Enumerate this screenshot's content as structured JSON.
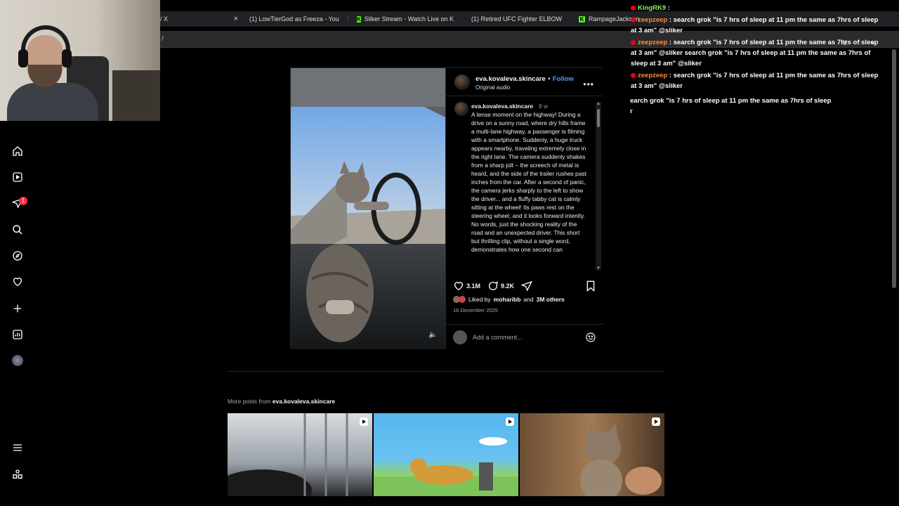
{
  "browser": {
    "tabs": [
      {
        "label": "/ X",
        "favicon": "x-icon"
      },
      {
        "label": "(1) LowTierGod as Freeza - You",
        "favicon": "youtube-icon"
      },
      {
        "label": "Sliker Stream - Watch Live on K",
        "favicon": "kick-icon"
      },
      {
        "label": "(1) Retired UFC Fighter ELBOW",
        "favicon": "youtube-icon"
      },
      {
        "label": "RampageJackson",
        "favicon": "kick-icon"
      }
    ],
    "url": "/"
  },
  "nav": {
    "notification_count": "1"
  },
  "post": {
    "username": "eva.kovaleva.skincare",
    "follow_label": "Follow",
    "separator": "•",
    "audio": "Original audio",
    "caption_user": "eva.kovaleva.skincare",
    "caption_time": "9 w",
    "caption": "A tense moment on the highway! During a drive on a sunny road, where dry hills frame a multi-lane highway, a passenger is filming with a smartphone. Suddenly, a huge truck appears nearby, traveling extremely close in the right lane. The camera suddenly shakes from a sharp jolt – the screech of metal is heard, and the side of the trailer rushes past inches from the car. After a second of panic, the camera jerks sharply to the left to show the driver... and a fluffy tabby cat is calmly sitting at the wheel! Its paws rest on the steering wheel, and it looks forward intently. No words, just the shocking reality of the road and an unexpected driver. This short but thrilling clip, without a single word, demonstrates how one second can",
    "likes": "3.1M",
    "comments": "9.2K",
    "liked_by_prefix": "Liked by",
    "liked_by_user": "moharibb",
    "liked_by_and": "and",
    "liked_by_others": "3M others",
    "date": "16 December 2025",
    "comment_placeholder": "Add a comment..."
  },
  "more_posts": {
    "prefix": "More posts from",
    "user": "eva.kovaleva.skincare"
  },
  "chat": [
    {
      "name": "KingRK9",
      "sep": " :",
      "text": "",
      "color": "#8cf25a"
    },
    {
      "name": "zeepzeep",
      "sep": " :",
      "text": " search grok \"is 7 hrs of sleep at 11 pm the same as 7hrs of sleep at 3 am\" @sliker",
      "color": "#ff8a3d"
    },
    {
      "name": "zeepzeep",
      "sep": " :",
      "text": " search grok \"is 7 hrs of sleep at 11 pm the same as 7hrs of sleep at 3 am\" @sliker search grok \"is 7 hrs of sleep at 11 pm the same as 7hrs of sleep at 3 am\" @sliker",
      "color": "#ff8a3d"
    },
    {
      "name": "zeepzeep",
      "sep": " :",
      "text": " search grok \"is 7 hrs of sleep at 11 pm the same as 7hrs of sleep at 3 am\" @sliker",
      "color": "#ff8a3d"
    }
  ],
  "chat_overflow": {
    "line1": "earch grok \"is 7 hrs of sleep at 11 pm the same as 7hrs of sleep",
    "line2": "r"
  }
}
